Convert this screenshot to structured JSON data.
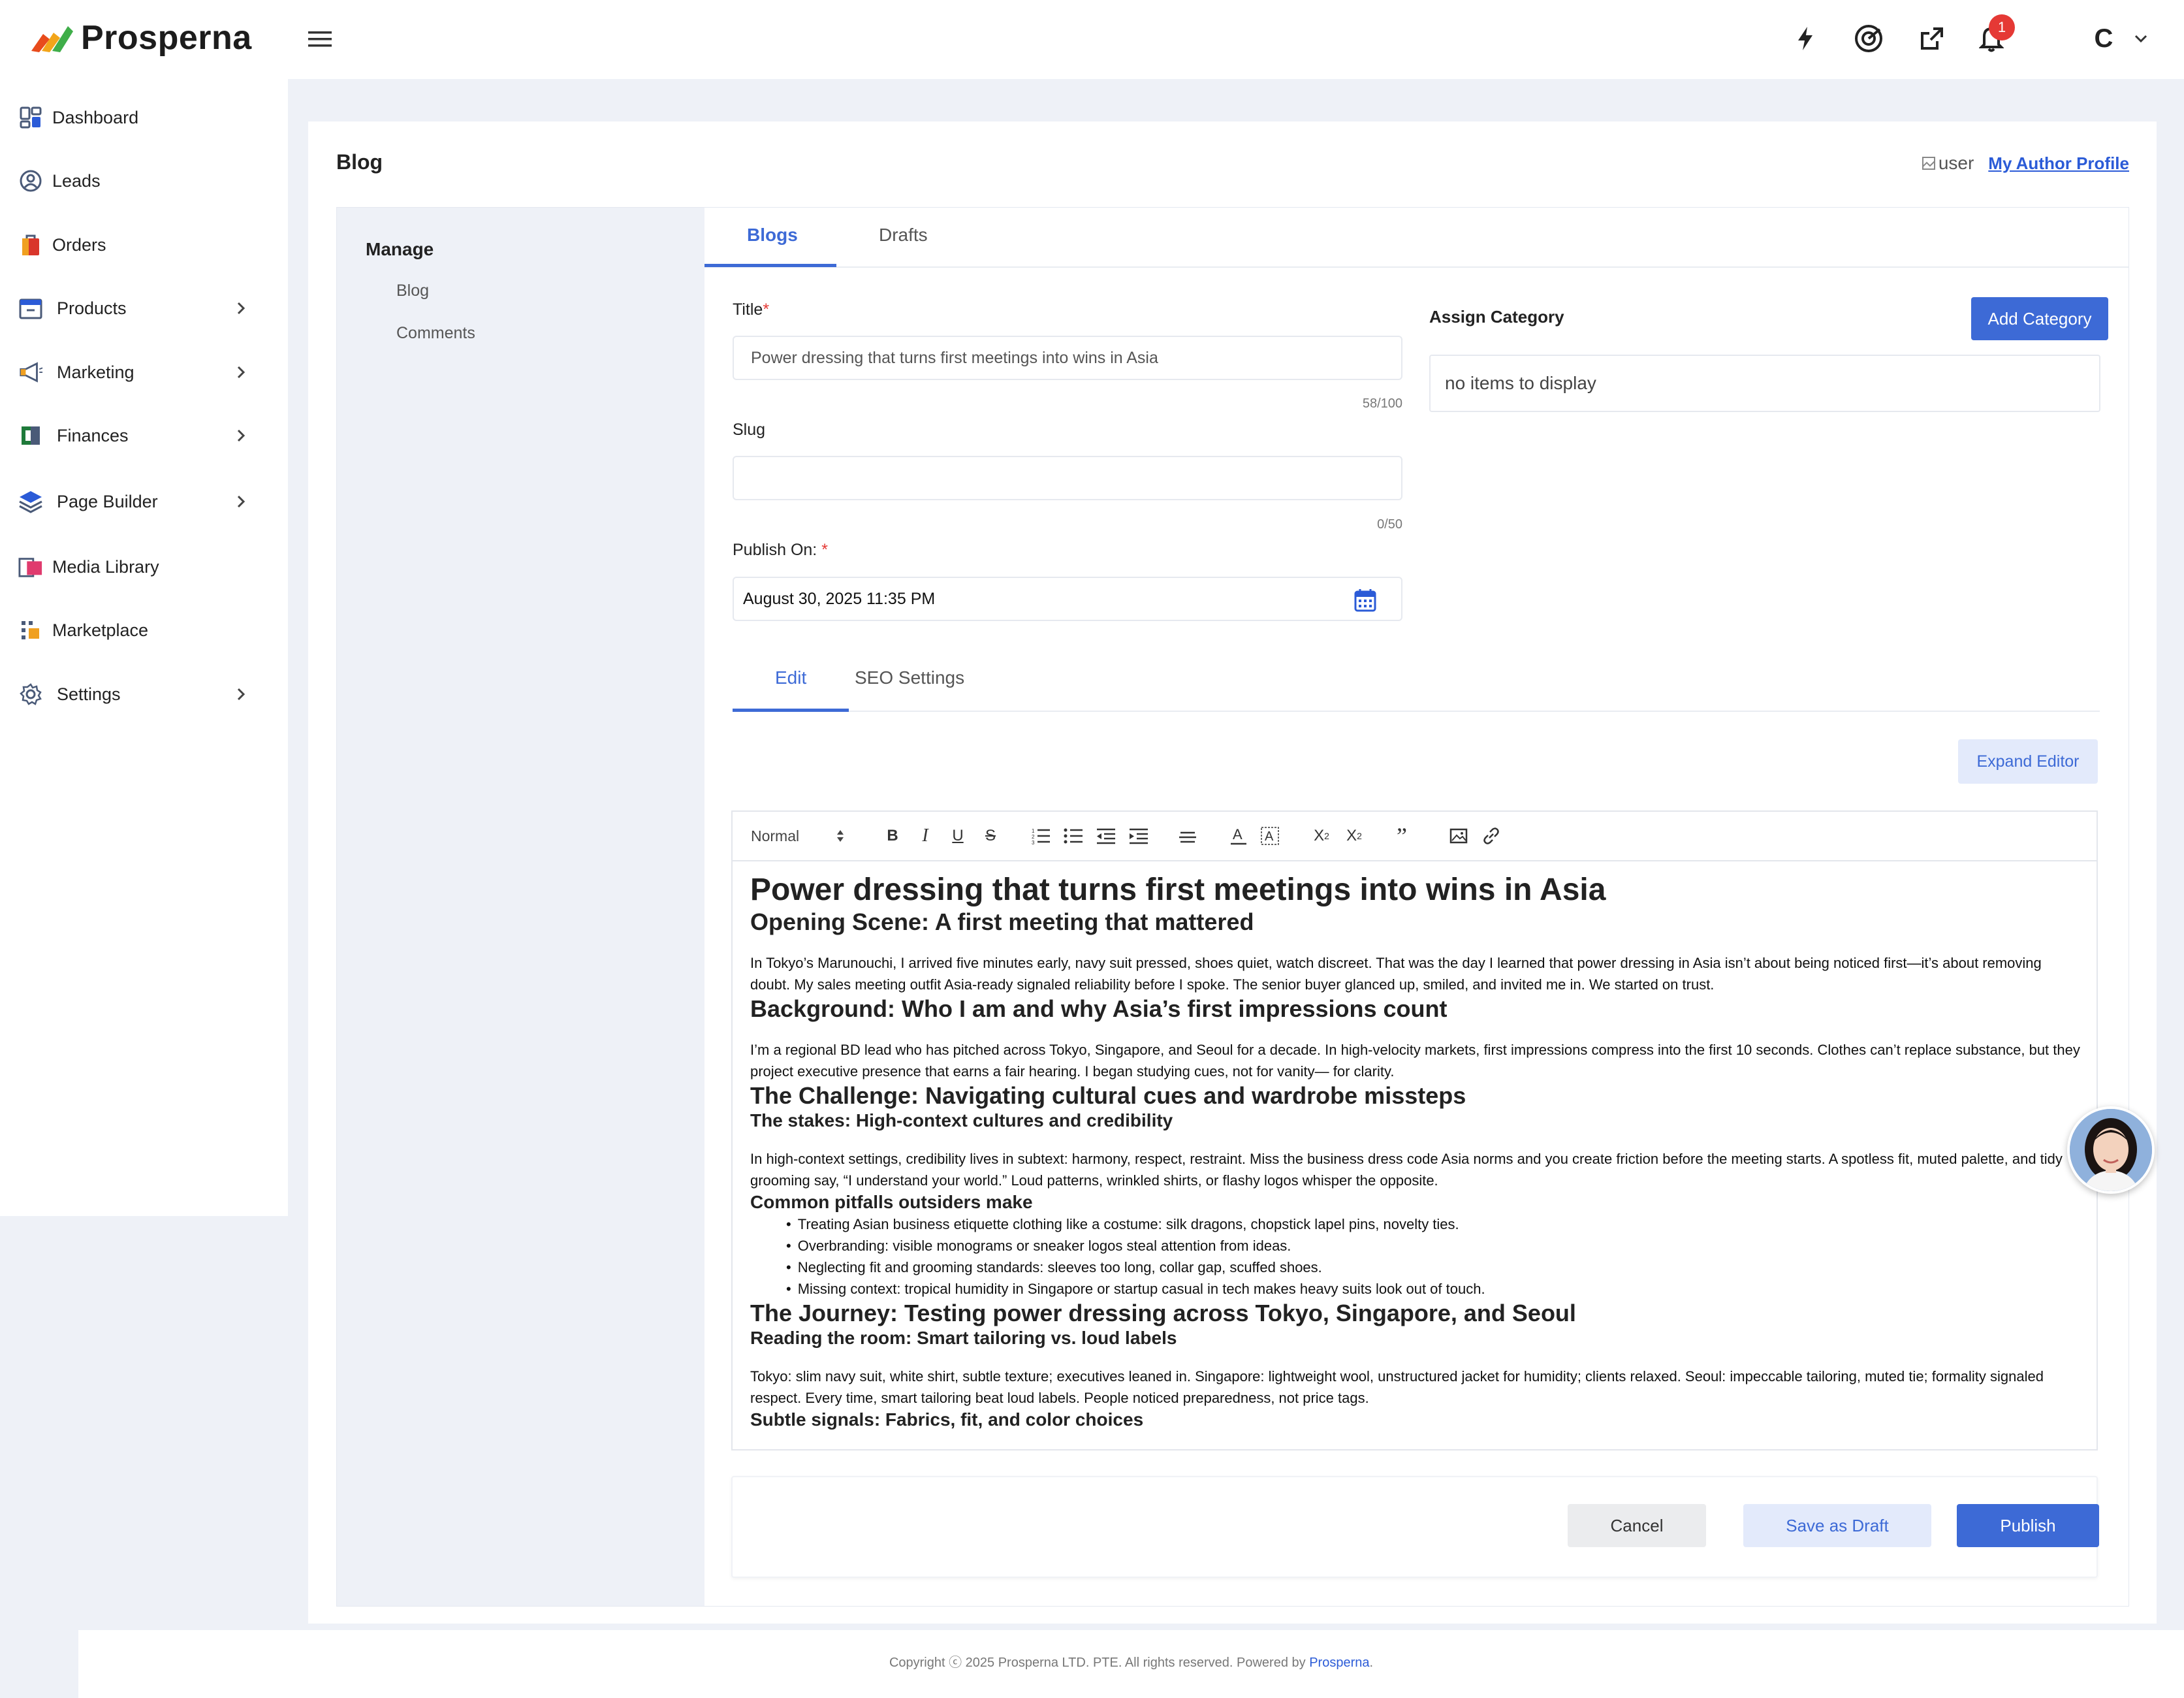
{
  "app": {
    "brand": "Prosperna"
  },
  "sidebar": {
    "items": [
      {
        "label": "Dashboard",
        "icon": "dashboard-icon",
        "has_children": false
      },
      {
        "label": "Leads",
        "icon": "leads-icon",
        "has_children": false
      },
      {
        "label": "Orders",
        "icon": "orders-icon",
        "has_children": false
      },
      {
        "label": "Products",
        "icon": "products-icon",
        "has_children": true
      },
      {
        "label": "Marketing",
        "icon": "megaphone-icon",
        "has_children": true
      },
      {
        "label": "Finances",
        "icon": "finances-icon",
        "has_children": true
      },
      {
        "label": "Page Builder",
        "icon": "layers-icon",
        "has_children": true
      },
      {
        "label": "Media Library",
        "icon": "media-library-icon",
        "has_children": false
      },
      {
        "label": "Marketplace",
        "icon": "marketplace-icon",
        "has_children": false
      },
      {
        "label": "Settings",
        "icon": "gear-icon",
        "has_children": true
      }
    ]
  },
  "topbar": {
    "notification_count": "1",
    "user_initial": "C"
  },
  "page": {
    "title": "Blog",
    "author_img_alt": "user",
    "author_link": "My Author Profile"
  },
  "manage": {
    "title": "Manage",
    "links": [
      "Blog",
      "Comments"
    ]
  },
  "tabs": [
    "Blogs",
    "Drafts"
  ],
  "form": {
    "title_label": "Title",
    "title_value": "Power dressing that turns first meetings into wins in Asia",
    "title_counter": "58/100",
    "slug_label": "Slug",
    "slug_value": "",
    "slug_counter": "0/50",
    "publish_label": "Publish On:",
    "publish_value": "August 30, 2025 11:35 PM",
    "category_label": "Assign Category",
    "add_category": "Add Category",
    "category_empty": "no items to display"
  },
  "edit_tabs": [
    "Edit",
    "SEO Settings"
  ],
  "expand_editor": "Expand Editor",
  "toolbar": {
    "format": "Normal"
  },
  "editor": {
    "h1": "Power dressing that turns first meetings into wins in Asia",
    "s1_h2": "Opening Scene: A first meeting that mattered",
    "s1_p": "In Tokyo’s Marunouchi, I arrived five minutes early, navy suit pressed, shoes quiet, watch discreet. That was the day I learned that power dressing in Asia isn’t about being noticed first—it’s about removing doubt. My sales meeting outfit Asia-ready signaled reliability before I spoke. The senior buyer glanced up, smiled, and invited me in. We started on trust.",
    "s2_h2": "Background: Who I am and why Asia’s first impressions count",
    "s2_p": "I’m a regional BD lead who has pitched across Tokyo, Singapore, and Seoul for a decade. In high-velocity markets, first impressions compress into the first 10 seconds. Clothes can’t replace substance, but they project executive presence that earns a fair hearing. I began studying cues, not for vanity— for clarity.",
    "s3_h2": "The Challenge: Navigating cultural cues and wardrobe missteps",
    "s3_h3": "The stakes: High-context cultures and credibility",
    "s3_p": "In high-context settings, credibility lives in subtext: harmony, respect, restraint. Miss the business dress code Asia norms and you create friction before the meeting starts. A spotless fit, muted palette, and tidy grooming say, “I understand your world.” Loud patterns, wrinkled shirts, or flashy logos whisper the opposite.",
    "s3_h3b": "Common pitfalls outsiders make",
    "s3_list": [
      "Treating Asian business etiquette clothing like a costume: silk dragons, chopstick lapel pins, novelty ties.",
      "Overbranding: visible monograms or sneaker logos steal attention from ideas.",
      "Neglecting fit and grooming standards: sleeves too long, collar gap, scuffed shoes.",
      "Missing context: tropical humidity in Singapore or startup casual in tech makes heavy suits look out of touch."
    ],
    "s4_h2": "The Journey: Testing power dressing across Tokyo, Singapore, and Seoul",
    "s4_h3": "Reading the room: Smart tailoring vs. loud labels",
    "s4_p": "Tokyo: slim navy suit, white shirt, subtle texture; executives leaned in. Singapore: lightweight wool, unstructured jacket for humidity; clients relaxed. Seoul: impeccable tailoring, muted tie; formality signaled respect. Every time, smart tailoring beat loud labels. People noticed preparedness, not price tags.",
    "s4_h3b": "Subtle signals: Fabrics, fit, and color choices"
  },
  "actions": {
    "cancel": "Cancel",
    "draft": "Save as Draft",
    "publish": "Publish"
  },
  "footer": {
    "text": "Copyright ⓒ 2025 Prosperna LTD. PTE. All rights reserved. Powered by ",
    "link": "Prosperna",
    "end": "."
  },
  "colors": {
    "accent": "#3d6ad6",
    "badge": "#e53935",
    "panel": "#eef1f7"
  }
}
